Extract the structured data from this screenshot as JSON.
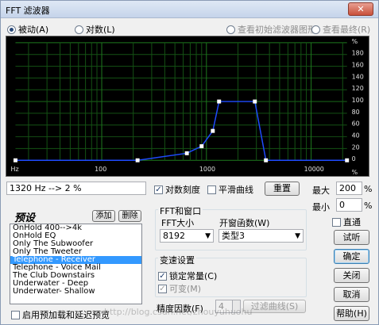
{
  "window": {
    "title": "FFT 滤波器",
    "close": "✕"
  },
  "view": {
    "passive": "被动(A)",
    "logarithmic": "对数(L)",
    "view_initial": "查看初始滤波器图形",
    "view_final": "查看最终(R)"
  },
  "chart_data": {
    "type": "line",
    "background": "#000000",
    "line_color": "#1f4bff",
    "x_scale": "log",
    "x_tick_labels": [
      "Hz",
      "100",
      "1000",
      "10000"
    ],
    "y_tick_labels": [
      "%",
      "180",
      "160",
      "140",
      "120",
      "100",
      "80",
      "60",
      "40",
      "20",
      "0",
      "%"
    ],
    "ylim": [
      0,
      200
    ],
    "grid": true,
    "series": [
      {
        "points": [
          [
            15,
            0
          ],
          [
            220,
            0
          ],
          [
            650,
            12
          ],
          [
            900,
            24
          ],
          [
            1150,
            50
          ],
          [
            1320,
            100
          ],
          [
            2900,
            100
          ],
          [
            3700,
            0
          ],
          [
            22000,
            0
          ]
        ]
      }
    ]
  },
  "readout": "1320 Hz --> 2 %",
  "options": {
    "log_scale": "对数刻度",
    "smooth": "平滑曲线",
    "reset": "重置"
  },
  "range": {
    "max_label": "最大",
    "max_value": "200",
    "min_label": "最小",
    "min_value": "0",
    "unit": "%"
  },
  "presets": {
    "title": "预设",
    "add": "添加",
    "delete": "删除",
    "items": [
      "OnHold 400-->4k",
      "OnHold EQ",
      "Only The Subwoofer",
      "Only The Tweeter",
      "Telephone - Receiver",
      "Telephone - Voice Mail",
      "The Club Downstairs",
      "Underwater - Deep",
      "Underwater- Shallow"
    ],
    "selected": "Telephone - Receiver",
    "preload": "启用预加载和延迟预览"
  },
  "fft": {
    "group_title": "FFT和窗口",
    "size_label": "FFT大小",
    "size_value": "8192",
    "window_label": "开窗函数(W)",
    "window_value": "类型3"
  },
  "morph": {
    "group_title": "变速设置",
    "lock": "锁定常量(C)",
    "variable": "可变(M)",
    "precision_label": "精度因数(F)",
    "precision_value": "4",
    "filter_curve": "过滤曲线(S)"
  },
  "side": {
    "bypass": "直通",
    "preview": "试听",
    "ok": "确定",
    "close": "关闭",
    "cancel": "取消",
    "help": "帮助(H)"
  },
  "watermark": "http://blog.csdn.net/zhouyuhuohu"
}
